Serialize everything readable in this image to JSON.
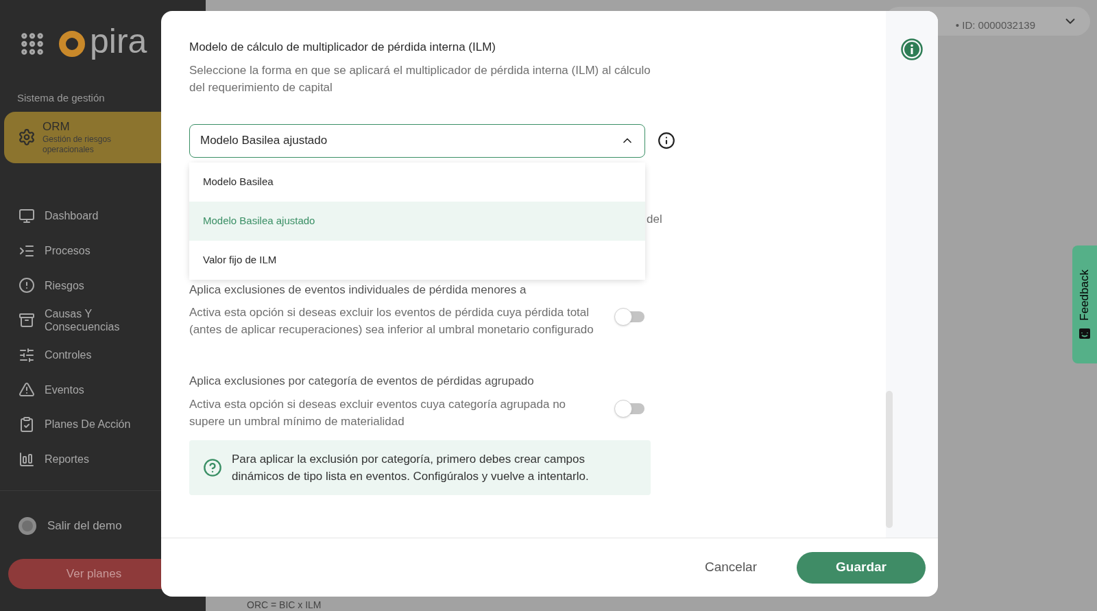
{
  "sidebar": {
    "logo_text": "pira",
    "section_label": "Sistema de gestión",
    "module": {
      "title": "ORM",
      "subtitle": "Gestión de riesgos operacionales"
    },
    "nav": [
      {
        "label": "Dashboard"
      },
      {
        "label": "Procesos"
      },
      {
        "label": "Riesgos"
      },
      {
        "label": "Causas Y Consecuencias"
      },
      {
        "label": "Controles"
      },
      {
        "label": "Eventos"
      },
      {
        "label": "Planes De Acción"
      },
      {
        "label": "Reportes"
      }
    ],
    "exit": "Salir del demo",
    "plans_button": "Ver planes"
  },
  "header": {
    "account_id": "• ID: 0000032139"
  },
  "background": {
    "formula": "ORC = BIC x ILM"
  },
  "feedback_tab": "Feedback",
  "modal": {
    "title": "Modelo de cálculo de multiplicador de pérdida interna (ILM)",
    "description": "Seleccione la forma en que se aplicará el multiplicador de pérdida interna (ILM) al cálculo del requerimiento de capital",
    "select": {
      "value": "Modelo Basilea ajustado",
      "expanded": true,
      "options": [
        {
          "label": "Modelo Basilea",
          "selected": false
        },
        {
          "label": "Modelo Basilea ajustado",
          "selected": true
        },
        {
          "label": "Valor fijo de ILM",
          "selected": false
        }
      ]
    },
    "covered_text_fragment": "del",
    "settings": [
      {
        "title": "Aplica exclusiones de eventos individuales de pérdida menores a",
        "description": "Activa esta opción si deseas excluir los eventos de pérdida cuya pérdida total (antes de aplicar recuperaciones) sea inferior al umbral monetario configurado",
        "on": false
      },
      {
        "title": "Aplica exclusiones por categoría de eventos de pérdidas agrupado",
        "description": "Activa esta opción si deseas excluir eventos cuya categoría agrupada no supere un umbral mínimo de materialidad",
        "on": false
      }
    ],
    "notice": "Para aplicar la exclusión por categoría, primero debes crear campos dinámicos de tipo lista en eventos. Configúralos y vuelve a intentarlo.",
    "cancel_button": "Cancelar",
    "save_button": "Guardar"
  }
}
